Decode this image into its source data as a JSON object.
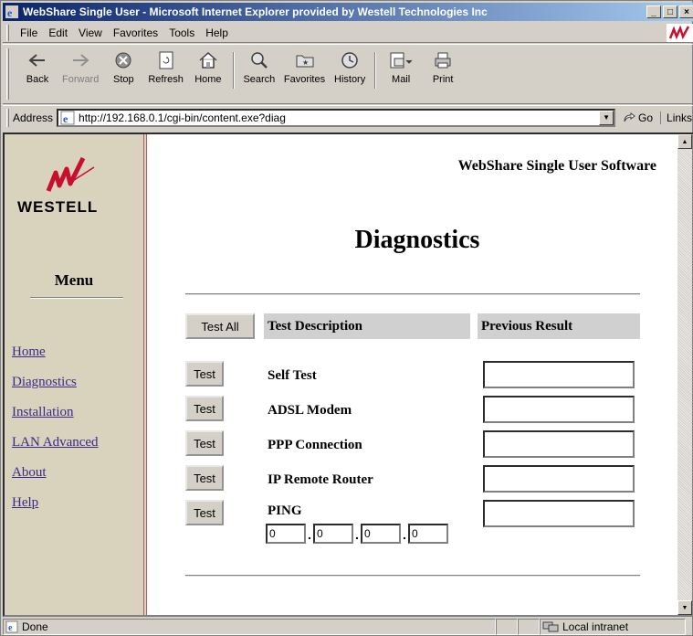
{
  "window": {
    "title": "WebShare Single User - Microsoft Internet Explorer provided by Westell Technologies Inc",
    "minimize": "_",
    "maximize": "□",
    "close": "×"
  },
  "menubar": {
    "items": [
      {
        "label": "File"
      },
      {
        "label": "Edit"
      },
      {
        "label": "View"
      },
      {
        "label": "Favorites"
      },
      {
        "label": "Tools"
      },
      {
        "label": "Help"
      }
    ]
  },
  "toolbar": {
    "buttons": [
      {
        "label": "Back",
        "icon": "back-arrow-icon"
      },
      {
        "label": "Forward",
        "icon": "forward-arrow-icon"
      },
      {
        "label": "Stop",
        "icon": "stop-icon"
      },
      {
        "label": "Refresh",
        "icon": "refresh-icon"
      },
      {
        "label": "Home",
        "icon": "home-icon"
      },
      {
        "label": "Search",
        "icon": "search-icon"
      },
      {
        "label": "Favorites",
        "icon": "favorites-icon"
      },
      {
        "label": "History",
        "icon": "history-icon"
      },
      {
        "label": "Mail",
        "icon": "mail-icon"
      },
      {
        "label": "Print",
        "icon": "print-icon"
      }
    ]
  },
  "address": {
    "label": "Address",
    "url": "http://192.168.0.1/cgi-bin/content.exe?diag",
    "go": "Go",
    "links": "Links"
  },
  "sidebar": {
    "logo_text": "WESTELL",
    "menu_title": "Menu",
    "nav": [
      {
        "label": "Home"
      },
      {
        "label": "Diagnostics"
      },
      {
        "label": "Installation"
      },
      {
        "label": "LAN Advanced"
      },
      {
        "label": "About"
      },
      {
        "label": "Help"
      }
    ]
  },
  "main": {
    "brand": "WebShare Single User Software",
    "title": "Diagnostics",
    "test_all_button": "Test All",
    "col_description": "Test Description",
    "col_result": "Previous Result",
    "tests": [
      {
        "button": "Test",
        "label": "Self Test",
        "result": ""
      },
      {
        "button": "Test",
        "label": "ADSL Modem",
        "result": ""
      },
      {
        "button": "Test",
        "label": "PPP Connection",
        "result": ""
      },
      {
        "button": "Test",
        "label": "IP Remote Router",
        "result": ""
      },
      {
        "button": "Test",
        "label": "PING",
        "result": ""
      }
    ],
    "ping_ip": [
      "0",
      "0",
      "0",
      "0"
    ],
    "ping_dot": "."
  },
  "status": {
    "text": "Done",
    "zone": "Local intranet"
  },
  "colors": {
    "titlebar_start": "#0a246a",
    "titlebar_end": "#a6caf0",
    "sidebar_bg": "#d9d2bd",
    "sidebar_border": "#b8586a",
    "nav_link": "#3a2a8a",
    "brand_red": "#c8102e"
  }
}
